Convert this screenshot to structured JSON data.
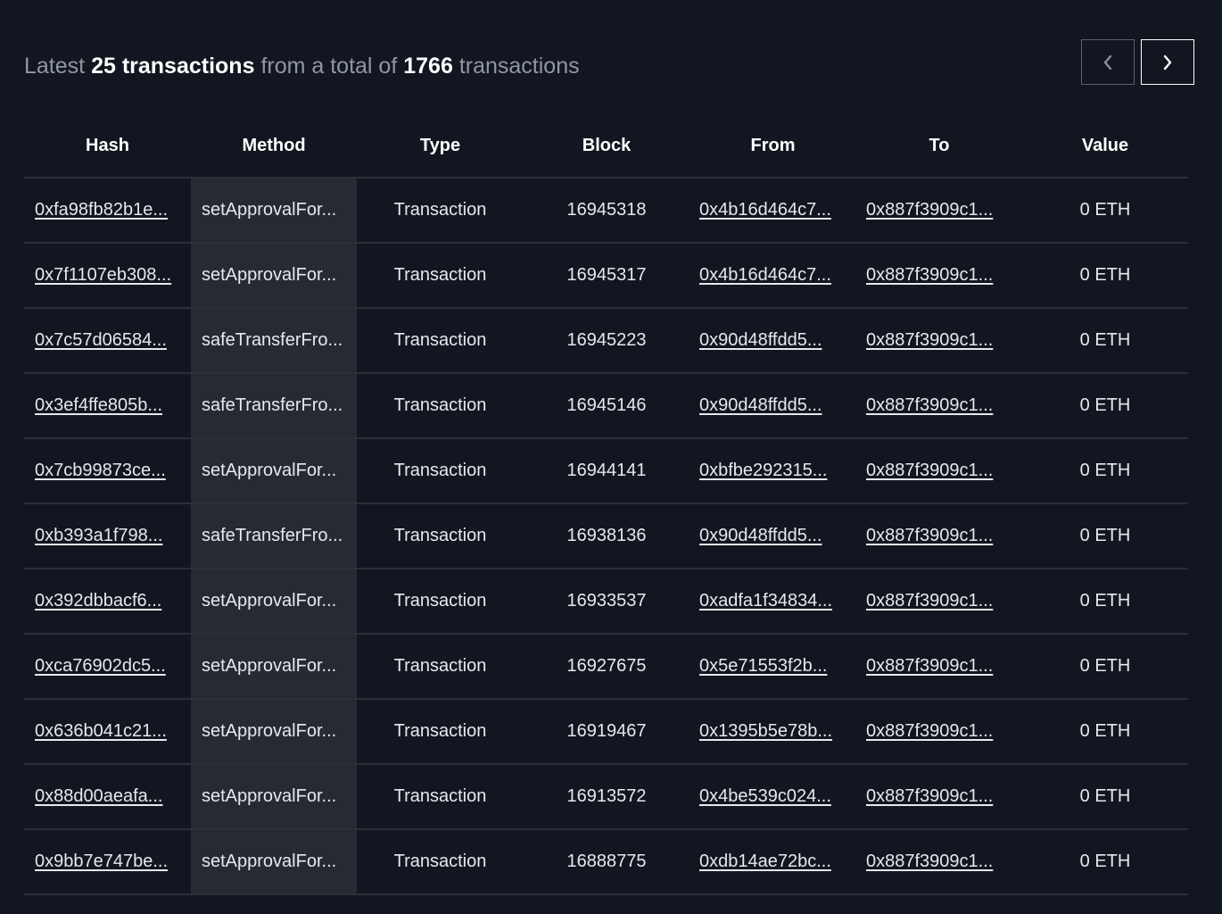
{
  "header": {
    "prefix": "Latest",
    "count_label": "25 transactions",
    "middle": "from a total of",
    "total": "1766",
    "suffix": "transactions"
  },
  "pager": {
    "prev_icon": "chevron-left-icon",
    "next_icon": "chevron-right-icon"
  },
  "columns": [
    "Hash",
    "Method",
    "Type",
    "Block",
    "From",
    "To",
    "Value"
  ],
  "rows": [
    {
      "hash": "0xfa98fb82b1e...",
      "method": "setApprovalFor...",
      "type": "Transaction",
      "block": "16945318",
      "from": "0x4b16d464c7...",
      "to": "0x887f3909c1...",
      "value": "0 ETH"
    },
    {
      "hash": "0x7f1107eb308...",
      "method": "setApprovalFor...",
      "type": "Transaction",
      "block": "16945317",
      "from": "0x4b16d464c7...",
      "to": "0x887f3909c1...",
      "value": "0 ETH"
    },
    {
      "hash": "0x7c57d06584...",
      "method": "safeTransferFro...",
      "type": "Transaction",
      "block": "16945223",
      "from": "0x90d48ffdd5...",
      "to": "0x887f3909c1...",
      "value": "0 ETH"
    },
    {
      "hash": "0x3ef4ffe805b...",
      "method": "safeTransferFro...",
      "type": "Transaction",
      "block": "16945146",
      "from": "0x90d48ffdd5...",
      "to": "0x887f3909c1...",
      "value": "0 ETH"
    },
    {
      "hash": "0x7cb99873ce...",
      "method": "setApprovalFor...",
      "type": "Transaction",
      "block": "16944141",
      "from": "0xbfbe292315...",
      "to": "0x887f3909c1...",
      "value": "0 ETH"
    },
    {
      "hash": "0xb393a1f798...",
      "method": "safeTransferFro...",
      "type": "Transaction",
      "block": "16938136",
      "from": "0x90d48ffdd5...",
      "to": "0x887f3909c1...",
      "value": "0 ETH"
    },
    {
      "hash": "0x392dbbacf6...",
      "method": "setApprovalFor...",
      "type": "Transaction",
      "block": "16933537",
      "from": "0xadfa1f34834...",
      "to": "0x887f3909c1...",
      "value": "0 ETH"
    },
    {
      "hash": "0xca76902dc5...",
      "method": "setApprovalFor...",
      "type": "Transaction",
      "block": "16927675",
      "from": "0x5e71553f2b...",
      "to": "0x887f3909c1...",
      "value": "0 ETH"
    },
    {
      "hash": "0x636b041c21...",
      "method": "setApprovalFor...",
      "type": "Transaction",
      "block": "16919467",
      "from": "0x1395b5e78b...",
      "to": "0x887f3909c1...",
      "value": "0 ETH"
    },
    {
      "hash": "0x88d00aeafa...",
      "method": "setApprovalFor...",
      "type": "Transaction",
      "block": "16913572",
      "from": "0x4be539c024...",
      "to": "0x887f3909c1...",
      "value": "0 ETH"
    },
    {
      "hash": "0x9bb7e747be...",
      "method": "setApprovalFor...",
      "type": "Transaction",
      "block": "16888775",
      "from": "0xdb14ae72bc...",
      "to": "0x887f3909c1...",
      "value": "0 ETH"
    }
  ]
}
